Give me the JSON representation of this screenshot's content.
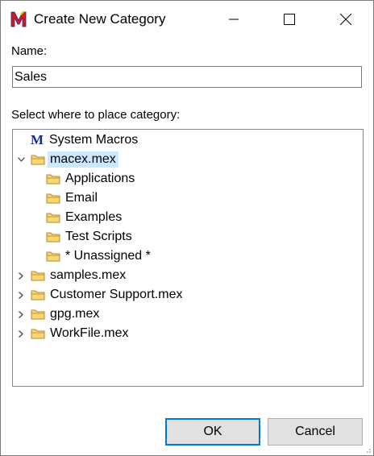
{
  "window": {
    "title": "Create New Category",
    "app_icon": "macro-express-icon"
  },
  "form": {
    "name_label": "Name:",
    "name_value": "Sales",
    "placement_label": "Select where to place category:"
  },
  "tree": {
    "items": [
      {
        "label": "System Macros",
        "icon": "m-icon",
        "level": 0,
        "expander": "none"
      },
      {
        "label": "macex.mex",
        "icon": "folder-icon",
        "level": 0,
        "expander": "expanded",
        "selected": true
      },
      {
        "label": "Applications",
        "icon": "folder-icon",
        "level": 1,
        "expander": "none"
      },
      {
        "label": "Email",
        "icon": "folder-icon",
        "level": 1,
        "expander": "none"
      },
      {
        "label": "Examples",
        "icon": "folder-icon",
        "level": 1,
        "expander": "none"
      },
      {
        "label": "Test Scripts",
        "icon": "folder-icon",
        "level": 1,
        "expander": "none"
      },
      {
        "label": "* Unassigned *",
        "icon": "folder-icon",
        "level": 1,
        "expander": "none"
      },
      {
        "label": "samples.mex",
        "icon": "folder-icon",
        "level": 0,
        "expander": "collapsed"
      },
      {
        "label": "Customer Support.mex",
        "icon": "folder-icon",
        "level": 0,
        "expander": "collapsed"
      },
      {
        "label": "gpg.mex",
        "icon": "folder-icon",
        "level": 0,
        "expander": "collapsed"
      },
      {
        "label": "WorkFile.mex",
        "icon": "folder-icon",
        "level": 0,
        "expander": "collapsed"
      }
    ]
  },
  "buttons": {
    "ok": "OK",
    "cancel": "Cancel"
  },
  "colors": {
    "selection": "#cce8ff",
    "default_button_border": "#0078d7",
    "folder_fill": "#f8d775",
    "folder_stroke": "#b08a2a"
  }
}
